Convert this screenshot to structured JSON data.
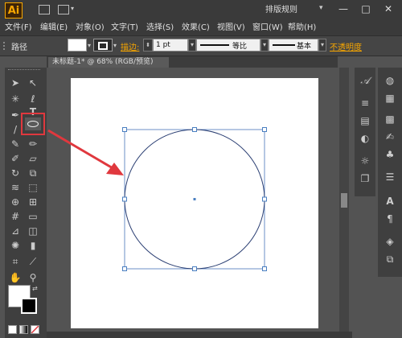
{
  "titlebar": {
    "logo": "Ai",
    "workspace": "排版规则",
    "minimize": "—",
    "maximize": "□",
    "close": "✕"
  },
  "menus": [
    "文件(F)",
    "编辑(E)",
    "对象(O)",
    "文字(T)",
    "选择(S)",
    "效果(C)",
    "视图(V)",
    "窗口(W)",
    "帮助(H)"
  ],
  "controlbar": {
    "selection_label": "路径",
    "stroke_label": "描边:",
    "stroke_value": "1 pt",
    "profile_label": "等比",
    "brush_label": "基本",
    "opacity_label": "不透明度"
  },
  "document": {
    "tab_title": "未标题-1* @ 68% (RGB/预览)"
  },
  "tools": [
    "selection-icon",
    "direct-selection-icon",
    "magic-wand-icon",
    "lasso-icon",
    "pen-icon",
    "type-icon",
    "line-icon",
    "ellipse-icon",
    "paintbrush-icon",
    "pencil-icon",
    "blob-brush-icon",
    "eraser-icon",
    "rotate-icon",
    "scale-icon",
    "width-icon",
    "free-transform-icon",
    "shape-builder-icon",
    "perspective-icon",
    "mesh-icon",
    "gradient-icon",
    "eyedropper-icon",
    "blend-icon",
    "symbol-sprayer-icon",
    "graph-icon",
    "artboard-icon",
    "slice-icon",
    "hand-icon",
    "zoom-icon"
  ],
  "colors": {
    "highlight": "#e0383e",
    "arrow": "#e0383e",
    "selection": "#4a7fc1",
    "circle_stroke": "#2b3f73"
  }
}
